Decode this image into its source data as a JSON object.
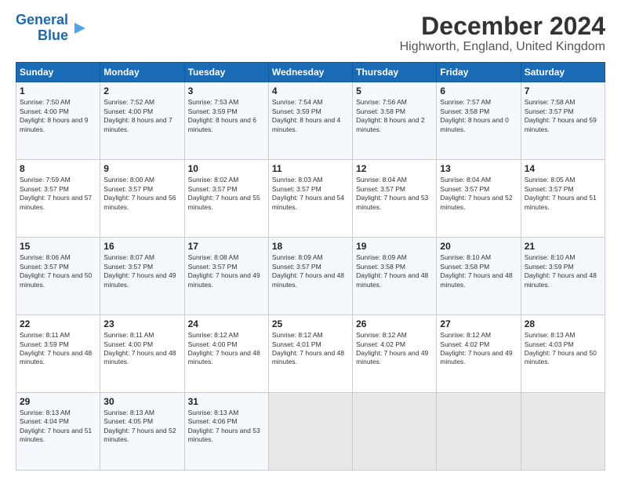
{
  "logo": {
    "line1": "General",
    "line2": "Blue"
  },
  "title": "December 2024",
  "subtitle": "Highworth, England, United Kingdom",
  "days_of_week": [
    "Sunday",
    "Monday",
    "Tuesday",
    "Wednesday",
    "Thursday",
    "Friday",
    "Saturday"
  ],
  "weeks": [
    [
      {
        "day": "1",
        "sunrise": "7:50 AM",
        "sunset": "4:00 PM",
        "daylight": "8 hours and 9 minutes."
      },
      {
        "day": "2",
        "sunrise": "7:52 AM",
        "sunset": "4:00 PM",
        "daylight": "8 hours and 7 minutes."
      },
      {
        "day": "3",
        "sunrise": "7:53 AM",
        "sunset": "3:59 PM",
        "daylight": "8 hours and 6 minutes."
      },
      {
        "day": "4",
        "sunrise": "7:54 AM",
        "sunset": "3:59 PM",
        "daylight": "8 hours and 4 minutes."
      },
      {
        "day": "5",
        "sunrise": "7:56 AM",
        "sunset": "3:58 PM",
        "daylight": "8 hours and 2 minutes."
      },
      {
        "day": "6",
        "sunrise": "7:57 AM",
        "sunset": "3:58 PM",
        "daylight": "8 hours and 0 minutes."
      },
      {
        "day": "7",
        "sunrise": "7:58 AM",
        "sunset": "3:57 PM",
        "daylight": "7 hours and 59 minutes."
      }
    ],
    [
      {
        "day": "8",
        "sunrise": "7:59 AM",
        "sunset": "3:57 PM",
        "daylight": "7 hours and 57 minutes."
      },
      {
        "day": "9",
        "sunrise": "8:00 AM",
        "sunset": "3:57 PM",
        "daylight": "7 hours and 56 minutes."
      },
      {
        "day": "10",
        "sunrise": "8:02 AM",
        "sunset": "3:57 PM",
        "daylight": "7 hours and 55 minutes."
      },
      {
        "day": "11",
        "sunrise": "8:03 AM",
        "sunset": "3:57 PM",
        "daylight": "7 hours and 54 minutes."
      },
      {
        "day": "12",
        "sunrise": "8:04 AM",
        "sunset": "3:57 PM",
        "daylight": "7 hours and 53 minutes."
      },
      {
        "day": "13",
        "sunrise": "8:04 AM",
        "sunset": "3:57 PM",
        "daylight": "7 hours and 52 minutes."
      },
      {
        "day": "14",
        "sunrise": "8:05 AM",
        "sunset": "3:57 PM",
        "daylight": "7 hours and 51 minutes."
      }
    ],
    [
      {
        "day": "15",
        "sunrise": "8:06 AM",
        "sunset": "3:57 PM",
        "daylight": "7 hours and 50 minutes."
      },
      {
        "day": "16",
        "sunrise": "8:07 AM",
        "sunset": "3:57 PM",
        "daylight": "7 hours and 49 minutes."
      },
      {
        "day": "17",
        "sunrise": "8:08 AM",
        "sunset": "3:57 PM",
        "daylight": "7 hours and 49 minutes."
      },
      {
        "day": "18",
        "sunrise": "8:09 AM",
        "sunset": "3:57 PM",
        "daylight": "7 hours and 48 minutes."
      },
      {
        "day": "19",
        "sunrise": "8:09 AM",
        "sunset": "3:58 PM",
        "daylight": "7 hours and 48 minutes."
      },
      {
        "day": "20",
        "sunrise": "8:10 AM",
        "sunset": "3:58 PM",
        "daylight": "7 hours and 48 minutes."
      },
      {
        "day": "21",
        "sunrise": "8:10 AM",
        "sunset": "3:59 PM",
        "daylight": "7 hours and 48 minutes."
      }
    ],
    [
      {
        "day": "22",
        "sunrise": "8:11 AM",
        "sunset": "3:59 PM",
        "daylight": "7 hours and 48 minutes."
      },
      {
        "day": "23",
        "sunrise": "8:11 AM",
        "sunset": "4:00 PM",
        "daylight": "7 hours and 48 minutes."
      },
      {
        "day": "24",
        "sunrise": "8:12 AM",
        "sunset": "4:00 PM",
        "daylight": "7 hours and 48 minutes."
      },
      {
        "day": "25",
        "sunrise": "8:12 AM",
        "sunset": "4:01 PM",
        "daylight": "7 hours and 48 minutes."
      },
      {
        "day": "26",
        "sunrise": "8:12 AM",
        "sunset": "4:02 PM",
        "daylight": "7 hours and 49 minutes."
      },
      {
        "day": "27",
        "sunrise": "8:12 AM",
        "sunset": "4:02 PM",
        "daylight": "7 hours and 49 minutes."
      },
      {
        "day": "28",
        "sunrise": "8:13 AM",
        "sunset": "4:03 PM",
        "daylight": "7 hours and 50 minutes."
      }
    ],
    [
      {
        "day": "29",
        "sunrise": "8:13 AM",
        "sunset": "4:04 PM",
        "daylight": "7 hours and 51 minutes."
      },
      {
        "day": "30",
        "sunrise": "8:13 AM",
        "sunset": "4:05 PM",
        "daylight": "7 hours and 52 minutes."
      },
      {
        "day": "31",
        "sunrise": "8:13 AM",
        "sunset": "4:06 PM",
        "daylight": "7 hours and 53 minutes."
      },
      null,
      null,
      null,
      null
    ]
  ]
}
